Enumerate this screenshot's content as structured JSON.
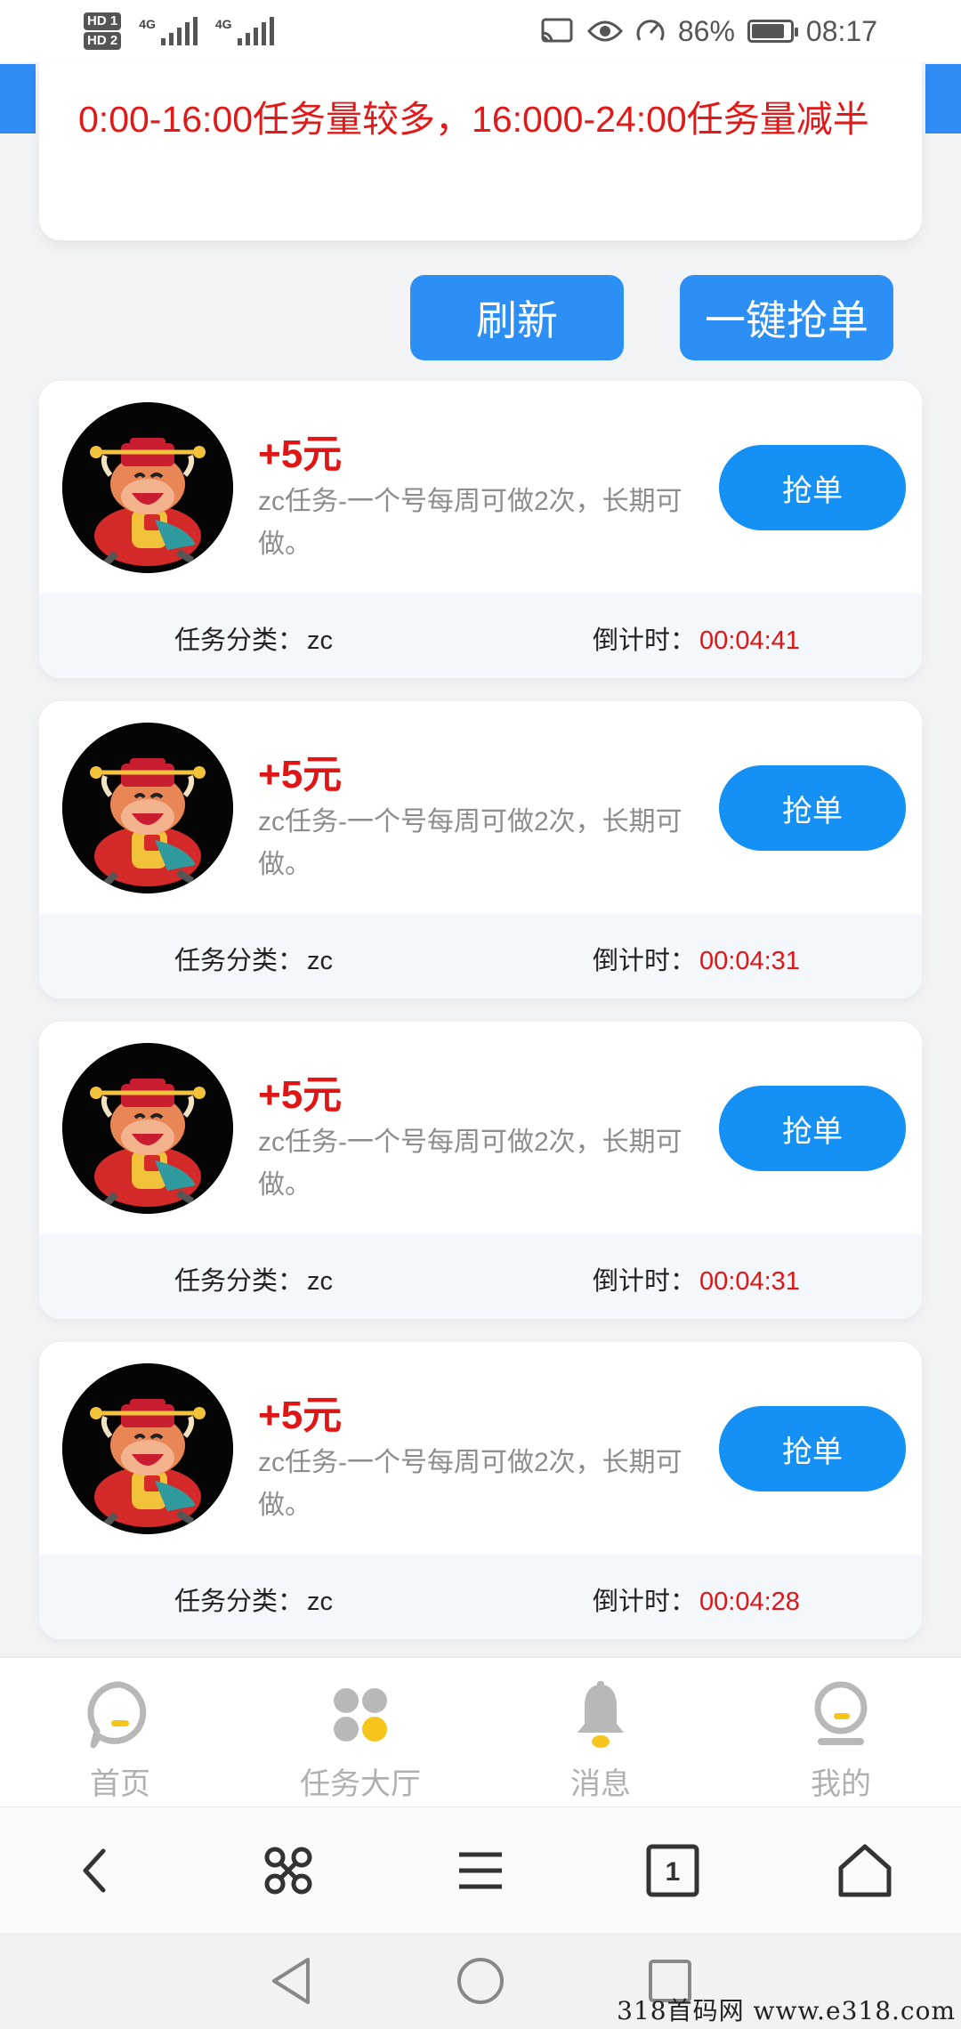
{
  "status_bar": {
    "hd1": "HD 1",
    "hd2": "HD 2",
    "net1": "4G",
    "net2": "4G",
    "battery_percent": "86%",
    "battery_level": 0.86,
    "time": "08:17"
  },
  "notice": {
    "text": "0:00-16:00任务量较多，16:000-24:00任务量减半"
  },
  "actions": {
    "refresh_label": "刷新",
    "grab_all_label": "一键抢单"
  },
  "tasks": [
    {
      "reward": "+5元",
      "description": "zc任务-一个号每周可做2次，长期可做。",
      "button_label": "抢单",
      "category_label": "任务分类：",
      "category": "zc",
      "countdown_label": "倒计时：",
      "countdown": "00:04:41"
    },
    {
      "reward": "+5元",
      "description": "zc任务-一个号每周可做2次，长期可做。",
      "button_label": "抢单",
      "category_label": "任务分类：",
      "category": "zc",
      "countdown_label": "倒计时：",
      "countdown": "00:04:31"
    },
    {
      "reward": "+5元",
      "description": "zc任务-一个号每周可做2次，长期可做。",
      "button_label": "抢单",
      "category_label": "任务分类：",
      "category": "zc",
      "countdown_label": "倒计时：",
      "countdown": "00:04:31"
    },
    {
      "reward": "+5元",
      "description": "zc任务-一个号每周可做2次，长期可做。",
      "button_label": "抢单",
      "category_label": "任务分类：",
      "category": "zc",
      "countdown_label": "倒计时：",
      "countdown": "00:04:28"
    }
  ],
  "tabbar": {
    "items": [
      {
        "label": "首页",
        "icon": "home-chat-icon"
      },
      {
        "label": "任务大厅",
        "icon": "task-hall-dots-icon"
      },
      {
        "label": "消息",
        "icon": "bell-icon"
      },
      {
        "label": "我的",
        "icon": "profile-icon"
      }
    ]
  },
  "browser_toolbar": {
    "tab_count": "1",
    "icons": [
      "back-icon",
      "command-icon",
      "menu-icon",
      "tabs-icon",
      "home-icon"
    ]
  },
  "system_nav": {
    "icons": [
      "nav-back-icon",
      "nav-home-icon",
      "nav-recents-icon"
    ]
  },
  "watermark": "318首码网 www.e318.com",
  "colors": {
    "accent_blue": "#1590f5",
    "reward_red": "#e01616",
    "tab_yellow": "#f6c51b",
    "tab_gray": "#b0b0b0"
  }
}
